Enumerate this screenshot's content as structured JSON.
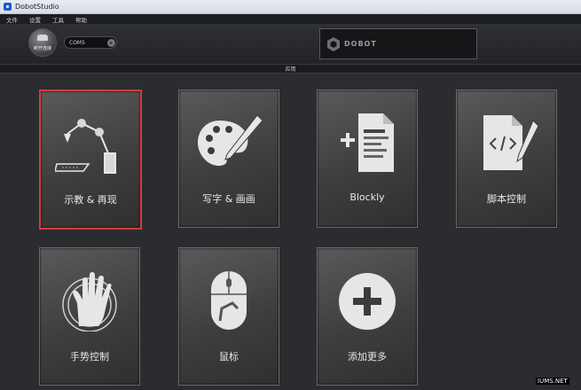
{
  "window": {
    "title": "DobotStudio"
  },
  "menu": [
    "文件",
    "设置",
    "工具",
    "帮助"
  ],
  "toolbar": {
    "connect_label": "断开连接",
    "port_value": "COM5",
    "brand": "DOBOT"
  },
  "section": {
    "title": "应用"
  },
  "tiles": [
    {
      "label": "示教 & 再现",
      "icon": "robot-arm-icon",
      "selected": true
    },
    {
      "label": "写字 & 画画",
      "icon": "palette-icon",
      "selected": false
    },
    {
      "label": "Blockly",
      "icon": "blockly-document-icon",
      "selected": false
    },
    {
      "label": "脚本控制",
      "icon": "script-icon",
      "selected": false
    },
    {
      "label": "手势控制",
      "icon": "hand-icon",
      "selected": false
    },
    {
      "label": "鼠标",
      "icon": "mouse-icon",
      "selected": false
    },
    {
      "label": "添加更多",
      "icon": "plus-icon",
      "selected": false
    }
  ],
  "watermark": "IUMS.NET",
  "colors": {
    "background": "#2a2c30",
    "selected_border": "#d43c3c",
    "tile": "#4a4a4a"
  }
}
